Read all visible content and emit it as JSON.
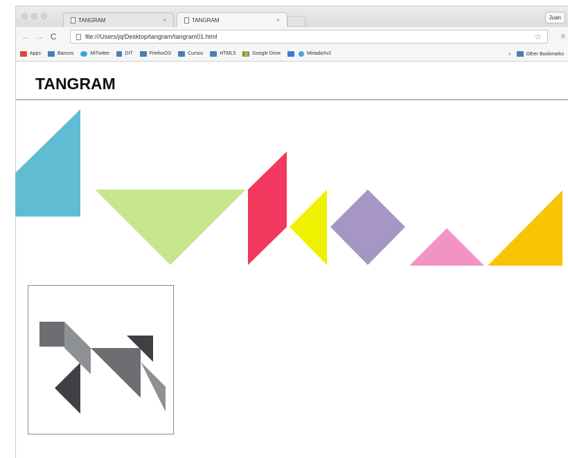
{
  "browser": {
    "tabs": [
      {
        "title": "TANGRAM",
        "active": false
      },
      {
        "title": "TANGRAM",
        "active": true
      }
    ],
    "profile_name": "Juan",
    "url": "file:///Users/jq/Desktop/tangram/tangram01.html",
    "bookmarks": [
      {
        "label": "Apps",
        "icon": "apps-grid-icon",
        "color": "#e0463c"
      },
      {
        "label": "Bancos",
        "icon": "folder-icon",
        "color": "#4a7fb6"
      },
      {
        "label": "MiTwitter",
        "icon": "twitter-bird-icon",
        "color": "#3aa3e3"
      },
      {
        "label": "DIT",
        "icon": "house-icon",
        "color": "#4a7fb6"
      },
      {
        "label": "FirefoxOS",
        "icon": "folder-icon",
        "color": "#4a7fb6"
      },
      {
        "label": "Cursos",
        "icon": "folder-icon",
        "color": "#4a7fb6"
      },
      {
        "label": "HTML5",
        "icon": "folder-icon",
        "color": "#4a7fb6"
      },
      {
        "label": "Google Drive",
        "icon": "drive-icon",
        "color": "#f4b400"
      },
      {
        "label": "",
        "icon": "bookmark-app-icon",
        "color": "#3b78d8"
      },
      {
        "label": "MiriadaXv2",
        "icon": "location-pin-icon",
        "color": "#4aa3df"
      }
    ],
    "other_bookmarks_label": "Other Bookmarks"
  },
  "page": {
    "title": "TANGRAM"
  },
  "pieces": [
    {
      "name": "blue-triangle",
      "color": "#5fbcd3"
    },
    {
      "name": "green-triangle",
      "color": "#c6e58d"
    },
    {
      "name": "red-parallelogram",
      "color": "#f2385e"
    },
    {
      "name": "yellow-triangle",
      "color": "#eef200"
    },
    {
      "name": "purple-square",
      "color": "#a596c4"
    },
    {
      "name": "pink-triangle",
      "color": "#f293c3"
    },
    {
      "name": "orange-triangle",
      "color": "#f9c401"
    }
  ],
  "figure": {
    "colors": {
      "dark": "#404044",
      "medium": "#6d6d72",
      "light": "#8e9193"
    }
  }
}
